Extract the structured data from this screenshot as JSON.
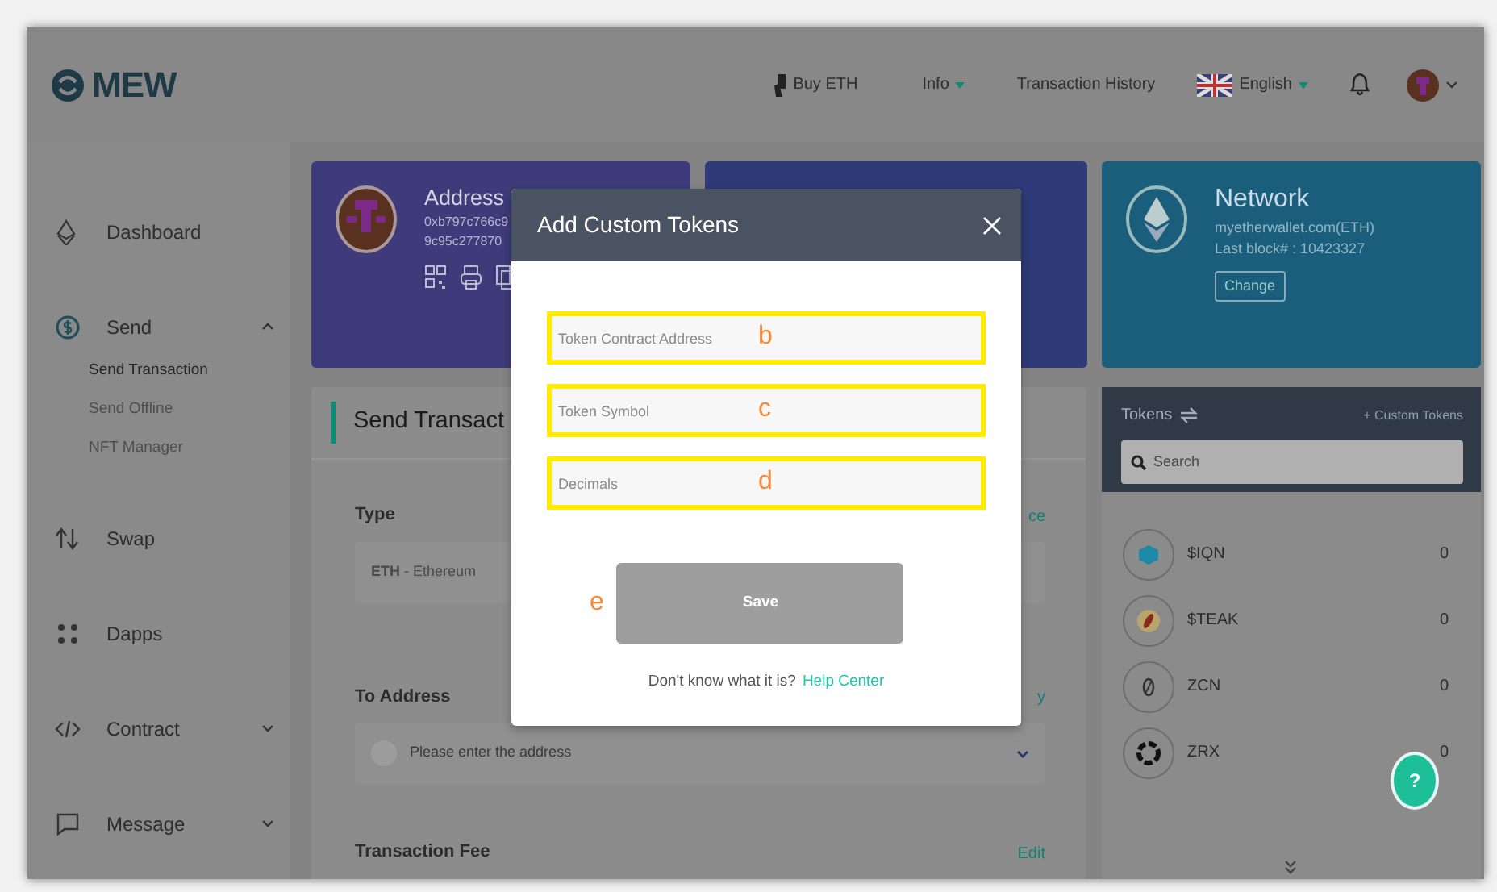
{
  "nav": {
    "logo": "MEW",
    "links": [
      {
        "kind": "buy",
        "label": "Buy ETH"
      },
      {
        "kind": "dropdown",
        "label": "Info"
      },
      {
        "kind": "plain",
        "label": "Transaction History"
      },
      {
        "kind": "language",
        "label": "English"
      }
    ]
  },
  "sidebar": {
    "items": [
      {
        "kind": "link",
        "label": "Dashboard"
      },
      {
        "kind": "group",
        "label": "Send",
        "expanded": true,
        "children": [
          {
            "label": "Send Transaction",
            "selected": true
          },
          {
            "label": "Send Offline",
            "selected": false
          },
          {
            "label": "NFT Manager",
            "selected": false
          }
        ]
      },
      {
        "kind": "link",
        "label": "Swap"
      },
      {
        "kind": "link",
        "label": "Dapps"
      },
      {
        "kind": "group",
        "label": "Contract",
        "expanded": false
      },
      {
        "kind": "group",
        "label": "Message",
        "expanded": false
      }
    ]
  },
  "address_card": {
    "title": "Address",
    "lines": [
      "0xb797c766c9",
      "9c95c277870"
    ]
  },
  "network_card": {
    "title": "Network",
    "lines": [
      "myetherwallet.com(ETH)",
      "Last block# : 10423327"
    ],
    "button": "Change"
  },
  "send_panel": {
    "title": "Send Transact",
    "type_label": "Type",
    "type_fragment": "ce",
    "type_value": "**ETH** - Ethereum",
    "to_label": "To Address",
    "to_fragment": "y",
    "to_placeholder": "Please enter the address",
    "fee_label": "Transaction Fee",
    "fee_action": "Edit"
  },
  "tokens": {
    "title": "Tokens",
    "custom_link": "+ Custom Tokens",
    "search_placeholder": "Search",
    "rows": [
      {
        "symbol": "$IQN",
        "balance": "0"
      },
      {
        "symbol": "$TEAK",
        "balance": "0"
      },
      {
        "symbol": "ZCN",
        "balance": "0"
      },
      {
        "symbol": "ZRX",
        "balance": "0"
      }
    ]
  },
  "help_bubble": "?",
  "modal": {
    "title": "Add Custom Tokens",
    "fields": [
      {
        "placeholder": "Token Contract Address",
        "annotation": "b"
      },
      {
        "placeholder": "Token Symbol",
        "annotation": "c"
      },
      {
        "placeholder": "Decimals",
        "annotation": "d"
      }
    ],
    "save": {
      "label": "Save",
      "annotation": "e",
      "disabled": true
    },
    "help_text": "Don't know what it is?",
    "help_link": "Help Center"
  }
}
